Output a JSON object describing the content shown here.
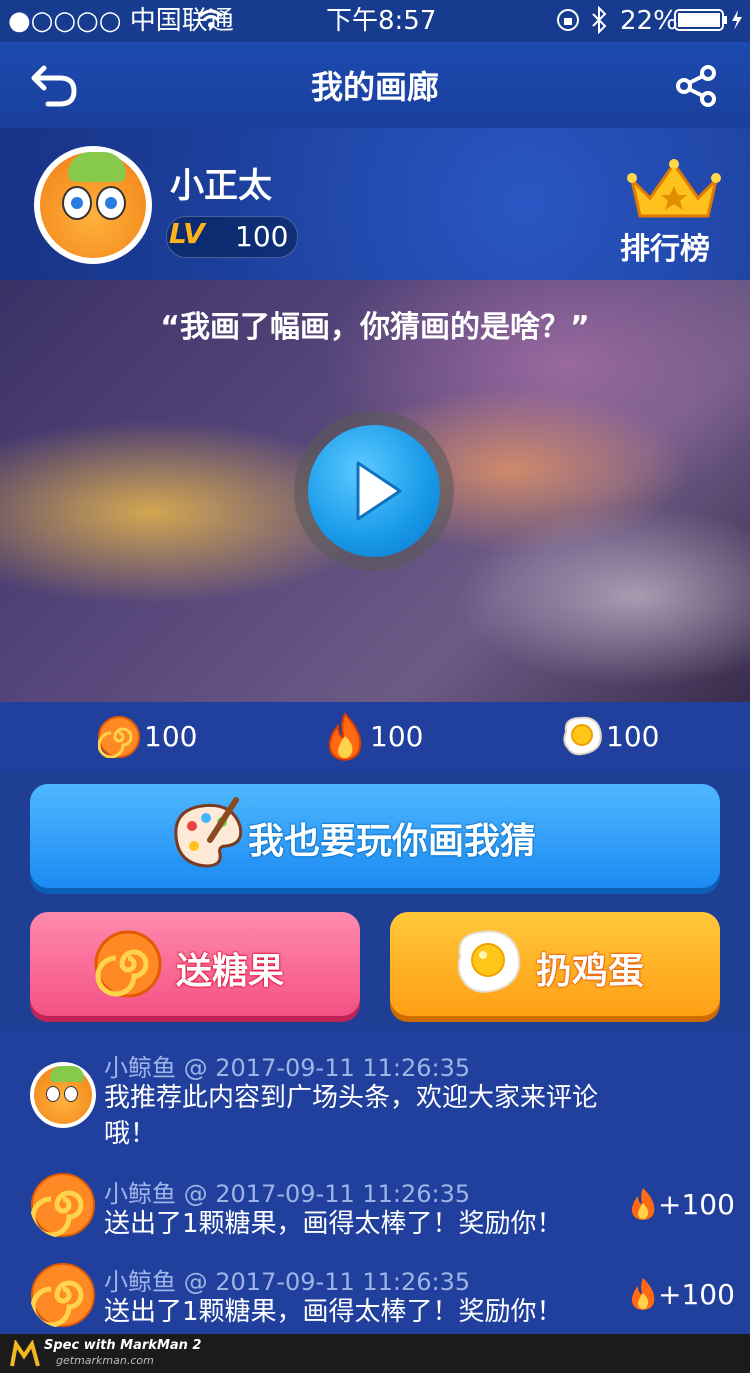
{
  "status_bar": {
    "carrier": "●○○○○ 中国联通",
    "time": "下午8:57",
    "battery": "22%"
  },
  "header": {
    "title": "我的画廊"
  },
  "profile": {
    "username": "小正太",
    "level_badge": "LV",
    "level": "100",
    "rank_label": "排行榜"
  },
  "video": {
    "caption": "“我画了幅画，你猜画的是啥？”"
  },
  "stats": [
    {
      "icon": "candy-icon",
      "value": "100"
    },
    {
      "icon": "flame-icon",
      "value": "100"
    },
    {
      "icon": "egg-icon",
      "value": "100"
    }
  ],
  "actions": {
    "play_game": "我也要玩你画我猜",
    "send_candy": "送糖果",
    "throw_egg": "扔鸡蛋"
  },
  "comments": [
    {
      "user": "小鲸鱼",
      "meta": "小鲸鱼 @ 2017-09-11  11:26:35",
      "text": "我推荐此内容到广场头条，欢迎大家来评论哦！",
      "avatar": "character-avatar",
      "reward": ""
    },
    {
      "user": "小鲸鱼",
      "meta": "小鲸鱼 @ 2017-09-11  11:26:35",
      "text": "送出了1颗糖果，画得太棒了！奖励你！",
      "avatar": "candy-avatar",
      "reward": "+100"
    },
    {
      "user": "小鲸鱼",
      "meta": "小鲸鱼 @ 2017-09-11  11:26:35",
      "text": "送出了1颗糖果，画得太棒了！奖励你！",
      "avatar": "candy-avatar",
      "reward": "+100"
    }
  ],
  "footer": {
    "line1": "Spec with MarkMan 2",
    "line2": "getmarkman.com"
  },
  "colors": {
    "background": "#1f3f95",
    "play_button": "#1b8af2",
    "candy_button": "#f45185",
    "egg_button": "#ff9f14"
  }
}
